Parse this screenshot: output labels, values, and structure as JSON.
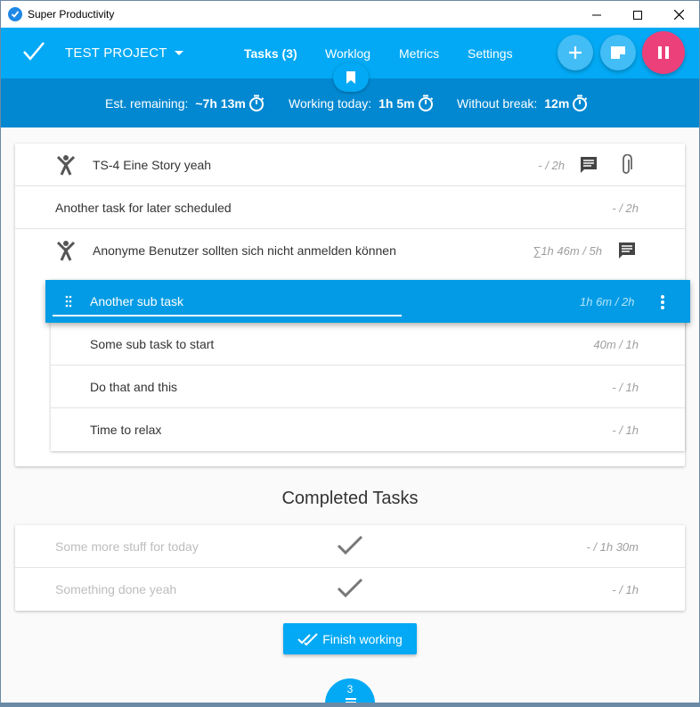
{
  "window": {
    "title": "Super Productivity"
  },
  "toolbar": {
    "project": "TEST PROJECT",
    "nav": {
      "tasks": "Tasks (3)",
      "worklog": "Worklog",
      "metrics": "Metrics",
      "settings": "Settings"
    }
  },
  "stats": {
    "est_remaining_label": "Est. remaining:",
    "est_remaining_value": "~7h 13m",
    "working_today_label": "Working today:",
    "working_today_value": "1h 5m",
    "without_break_label": "Without break:",
    "without_break_value": "12m"
  },
  "tasks": [
    {
      "title": "TS-4 Eine Story yeah",
      "estimate": "- / 2h"
    },
    {
      "title": "Another task for later scheduled",
      "estimate": "- / 2h"
    },
    {
      "title": "Anonyme Benutzer sollten sich nicht anmelden können",
      "estimate": "∑1h 46m / 5h"
    }
  ],
  "active_subtask": {
    "title": "Another sub task",
    "estimate": "1h 6m / 2h"
  },
  "subtasks": [
    {
      "title": "Some sub task to start",
      "estimate": "40m / 1h"
    },
    {
      "title": "Do that and this",
      "estimate": "- / 1h"
    },
    {
      "title": "Time to relax",
      "estimate": "- / 1h"
    }
  ],
  "completed": {
    "heading": "Completed Tasks",
    "items": [
      {
        "title": "Some more stuff for today",
        "estimate": "- / 1h 30m"
      },
      {
        "title": "Something done yeah",
        "estimate": "- / 1h"
      }
    ]
  },
  "finish_button": "Finish working",
  "backlog_count": "3",
  "colors": {
    "primary": "#03a9f4",
    "primary_dark": "#0288d1",
    "accent": "#ec407a"
  }
}
